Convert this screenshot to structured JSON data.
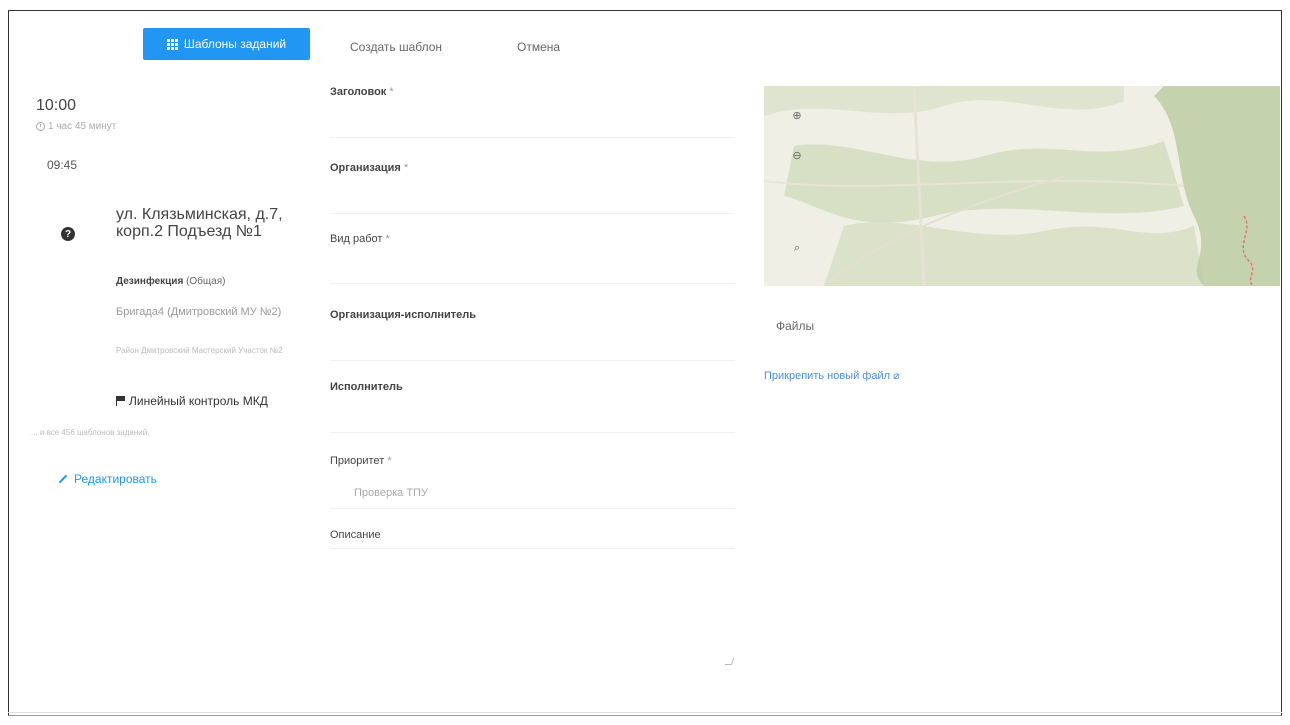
{
  "toolbar": {
    "templates_button": "Шаблоны заданий",
    "create_template": "Создать шаблон",
    "cancel": "Отмена"
  },
  "task_card": {
    "time_main": "10:00",
    "duration": "1 час 45 минут",
    "time_secondary": "09:45",
    "address": "ул. Клязьминская, д.7, корп.2 Подъезд №1",
    "work_type_bold": "Дезинфекция",
    "work_type_sub": "(Общая)",
    "brigade": "Бригада4 (Дмитровский МУ №2)",
    "district": "Район Дмитровский Мастерский Участок №2",
    "control": "Линейный контроль МКД",
    "all_templates": "... и все 456 шаблонов заданий.",
    "edit_link": "Редактировать"
  },
  "form": {
    "title_label": "Заголовок",
    "organization_label": "Организация",
    "work_kind_label": "Вид работ",
    "executor_org_label": "Организация-исполнитель",
    "executor_label": "Исполнитель",
    "priority_label": "Приоритет",
    "priority_placeholder": "Проверка ТПУ",
    "description_label": "Описание",
    "required_mark": "*"
  },
  "side": {
    "files_label": "Файлы",
    "attach_link": "Прикрепить новый файл"
  },
  "icons": {
    "templates_button": "grid-icon",
    "duration": "clock-icon",
    "task_status": "question-circle-icon",
    "control": "flag-icon",
    "edit": "pencil-icon",
    "attach": "paperclip-icon",
    "map_controls": [
      "zoom-in-icon",
      "zoom-out-icon",
      "search-icon"
    ]
  },
  "colors": {
    "accent": "#2196f3",
    "link": "#4a90e2",
    "map_green": "#c9d6b0"
  }
}
